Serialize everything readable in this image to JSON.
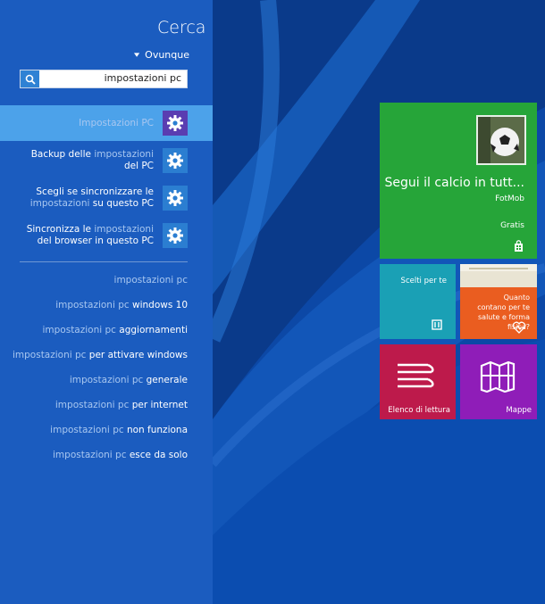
{
  "search": {
    "title": "Cerca",
    "scope": "Ovunque",
    "query": "impostazioni pc"
  },
  "results": [
    {
      "parts": [
        {
          "t": "Impostazioni PC",
          "h": true
        }
      ],
      "selected": true
    },
    {
      "parts": [
        {
          "t": "Backup delle ",
          "h": false
        },
        {
          "t": "impostazioni",
          "h": true
        },
        {
          "t": " del PC",
          "h": false
        }
      ],
      "selected": false
    },
    {
      "parts": [
        {
          "t": "Scegli se sincronizzare le ",
          "h": false
        },
        {
          "t": "impostazioni",
          "h": true
        },
        {
          "t": " su questo PC",
          "h": false
        }
      ],
      "selected": false
    },
    {
      "parts": [
        {
          "t": "Sincronizza le ",
          "h": false
        },
        {
          "t": "impostazioni",
          "h": true
        },
        {
          "t": " del browser in questo PC",
          "h": false
        }
      ],
      "selected": false
    }
  ],
  "suggestions": [
    {
      "prefix": "impostazioni pc",
      "rest": ""
    },
    {
      "prefix": "impostazioni pc",
      "rest": " windows 10"
    },
    {
      "prefix": "impostazioni pc",
      "rest": " aggiornamenti"
    },
    {
      "prefix": "impostazioni pc",
      "rest": " per attivare windows"
    },
    {
      "prefix": "impostazioni pc",
      "rest": " generale"
    },
    {
      "prefix": "impostazioni pc",
      "rest": " per internet"
    },
    {
      "prefix": "impostazioni pc",
      "rest": " non funziona"
    },
    {
      "prefix": "impostazioni pc",
      "rest": " esce da solo"
    }
  ],
  "tiles": {
    "fotmob": {
      "headline": "Segui il calcio in tutt...",
      "publisher": "FotMob",
      "price": "Gratis",
      "icon": "store-icon"
    },
    "scelti": {
      "label": "Scelti per te",
      "icon": "store-icon"
    },
    "salute": {
      "label": "Quanto contano per te salute e forma fisica?",
      "icon": "heart-pulse-icon"
    },
    "lettura": {
      "label": "Elenco di lettura",
      "icon": "reading-list-icon"
    },
    "mappe": {
      "label": "Mappe",
      "icon": "map-icon"
    }
  },
  "colors": {
    "charm": "#1b5cbf",
    "selected": "#4ca2ea",
    "fotmob": "#26a539",
    "scelti": "#1aa0b5",
    "salute": "#ea5d20",
    "lettura": "#bd1a4b",
    "mappe": "#8f1db8"
  }
}
